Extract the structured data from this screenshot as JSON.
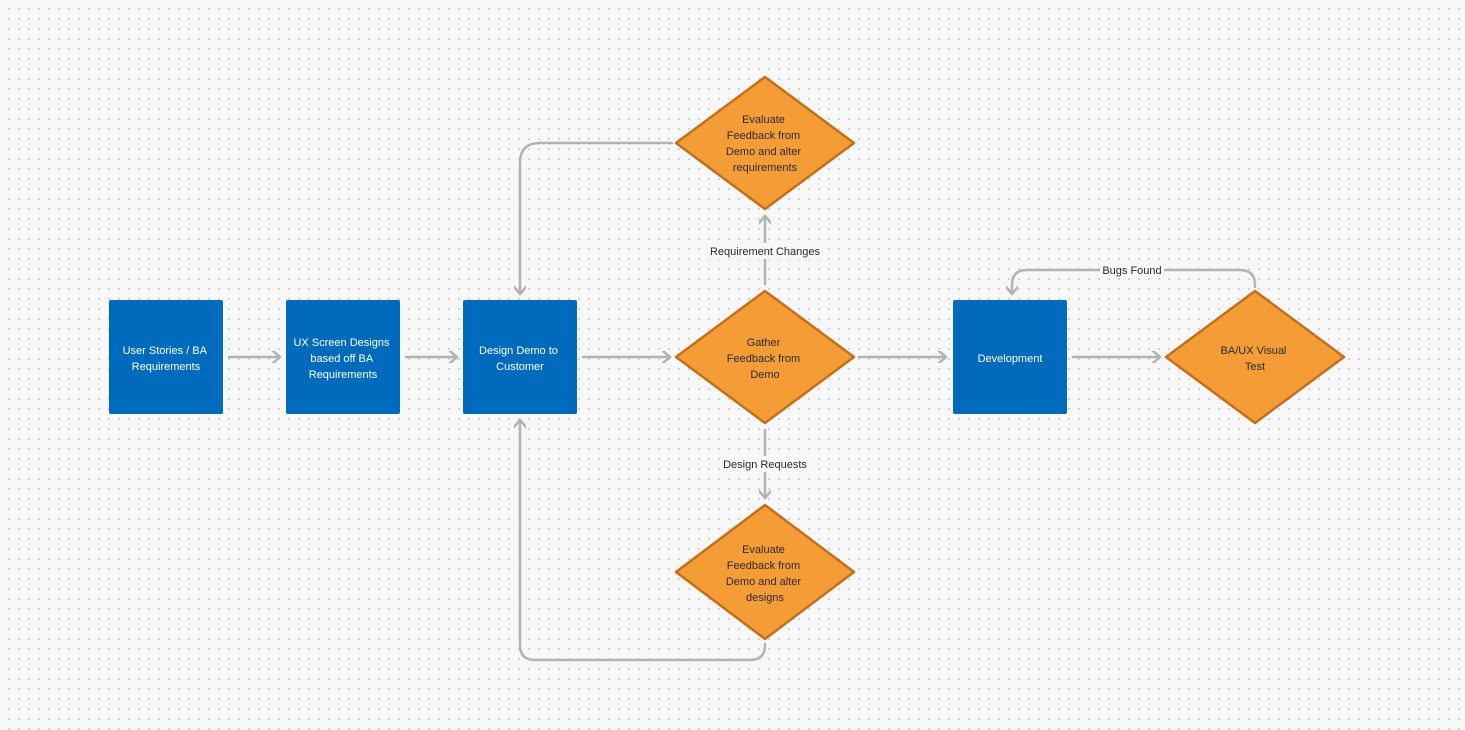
{
  "colors": {
    "process": "#006bbd",
    "decision": "#f49d37",
    "decision_border": "#c46f1b",
    "connector": "#b3b3b3"
  },
  "nodes": {
    "user_stories": {
      "lines": [
        "User Stories / BA",
        "Requirements"
      ]
    },
    "ux_designs": {
      "lines": [
        "UX Screen Designs",
        "based off BA",
        "Requirements"
      ]
    },
    "design_demo": {
      "lines": [
        "Design Demo to",
        "Customer"
      ]
    },
    "gather_feedback": {
      "lines": [
        "Gather",
        "Feedback from",
        "Demo"
      ]
    },
    "eval_requirements": {
      "lines": [
        "Evaluate",
        "Feedback from",
        "Demo and alter",
        "requirements"
      ]
    },
    "eval_designs": {
      "lines": [
        "Evaluate",
        "Feedback from",
        "Demo and alter",
        "designs"
      ]
    },
    "development": {
      "lines": [
        "Development"
      ]
    },
    "visual_test": {
      "lines": [
        "BA/UX Visual",
        "Test"
      ]
    }
  },
  "edge_labels": {
    "requirement_changes": "Requirement Changes",
    "design_requests": "Design Requests",
    "bugs_found": "Bugs Found"
  }
}
